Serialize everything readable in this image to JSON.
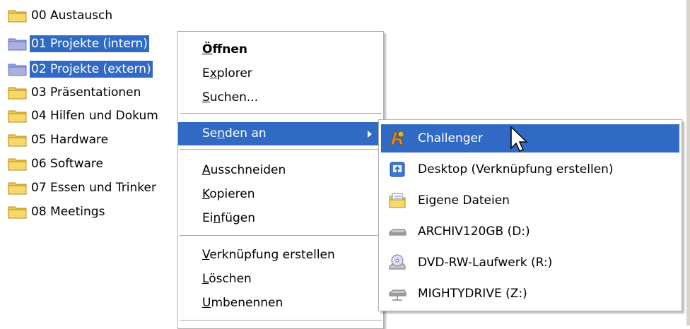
{
  "folders": [
    {
      "label": "00 Austausch"
    },
    {
      "label": "01 Projekte (intern)"
    },
    {
      "label": "02 Projekte (extern)"
    },
    {
      "label": "03 Präsentationen"
    },
    {
      "label": "04 Hilfen und Dokum"
    },
    {
      "label": "05 Hardware"
    },
    {
      "label": "06 Software"
    },
    {
      "label": "07 Essen und Trinker"
    },
    {
      "label": "08 Meetings"
    }
  ],
  "context_menu": {
    "open_pre": "",
    "open_u": "Ö",
    "open_post": "ffnen",
    "explorer_pre": "E",
    "explorer_u": "x",
    "explorer_post": "plorer",
    "search_pre": "",
    "search_u": "S",
    "search_post": "uchen...",
    "sendto_pre": "Se",
    "sendto_u": "n",
    "sendto_post": "den an",
    "cut_pre": "",
    "cut_u": "A",
    "cut_post": "usschneiden",
    "copy_pre": "",
    "copy_u": "K",
    "copy_post": "opieren",
    "paste_pre": "Ei",
    "paste_u": "n",
    "paste_post": "fügen",
    "shortcut_pre": "",
    "shortcut_u": "V",
    "shortcut_post": "erknüpfung erstellen",
    "delete_pre": "",
    "delete_u": "L",
    "delete_post": "öschen",
    "rename_pre": "",
    "rename_u": "U",
    "rename_post": "mbenennen"
  },
  "sendto_menu": [
    {
      "label": "Challenger",
      "icon": "challenger-app-icon"
    },
    {
      "label": "Desktop (Verknüpfung erstellen)",
      "icon": "desktop-icon"
    },
    {
      "label": "Eigene Dateien",
      "icon": "documents-folder-icon"
    },
    {
      "label": "ARCHIV120GB (D:)",
      "icon": "hard-drive-icon"
    },
    {
      "label": "DVD-RW-Laufwerk (R:)",
      "icon": "dvd-drive-icon"
    },
    {
      "label": "MIGHTYDRIVE (Z:)",
      "icon": "network-drive-icon"
    }
  ],
  "colors": {
    "selection": "#316ac5",
    "menu_border": "#acaeab"
  }
}
